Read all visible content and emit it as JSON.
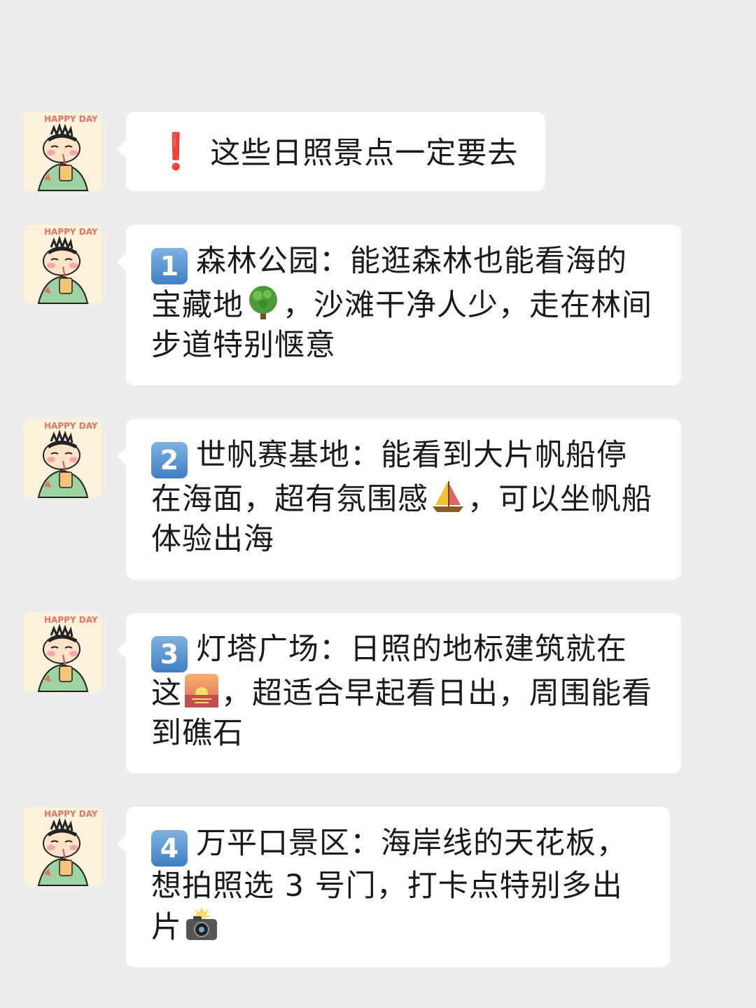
{
  "messages": [
    {
      "type": "title",
      "icon": "exclamation-icon",
      "text": "这些日照景点一定要去"
    },
    {
      "type": "item",
      "number": "1",
      "title": "森林公园：",
      "part1": "能逛森林也能看海的宝藏地",
      "emoji": "tree-icon",
      "part2": "，沙滩干净人少，走在林间步道特别惬意"
    },
    {
      "type": "item",
      "number": "2",
      "title": "世帆赛基地：",
      "part1": "能看到大片帆船停在海面，超有氛围感",
      "emoji": "sailboat-icon",
      "part2": "，可以坐帆船体验出海"
    },
    {
      "type": "item",
      "number": "3",
      "title": "灯塔广场：",
      "part1": "日照的地标建筑就在这",
      "emoji": "sunrise-icon",
      "part2": "，超适合早起看日出，周围能看到礁石"
    },
    {
      "type": "item",
      "number": "4",
      "title": "万平口景区：",
      "part1": "海岸线的天花板，想拍照选 3 号门，打卡点特别多出片",
      "emoji": "camera-flash-icon",
      "part2": ""
    }
  ],
  "avatar": {
    "icon": "avatar-happy-day",
    "text": "HAPPY DAY"
  },
  "colors": {
    "background": "#ededed",
    "bubble": "#ffffff",
    "badge": "#4a88cc",
    "exclamation": "#e0242b"
  }
}
